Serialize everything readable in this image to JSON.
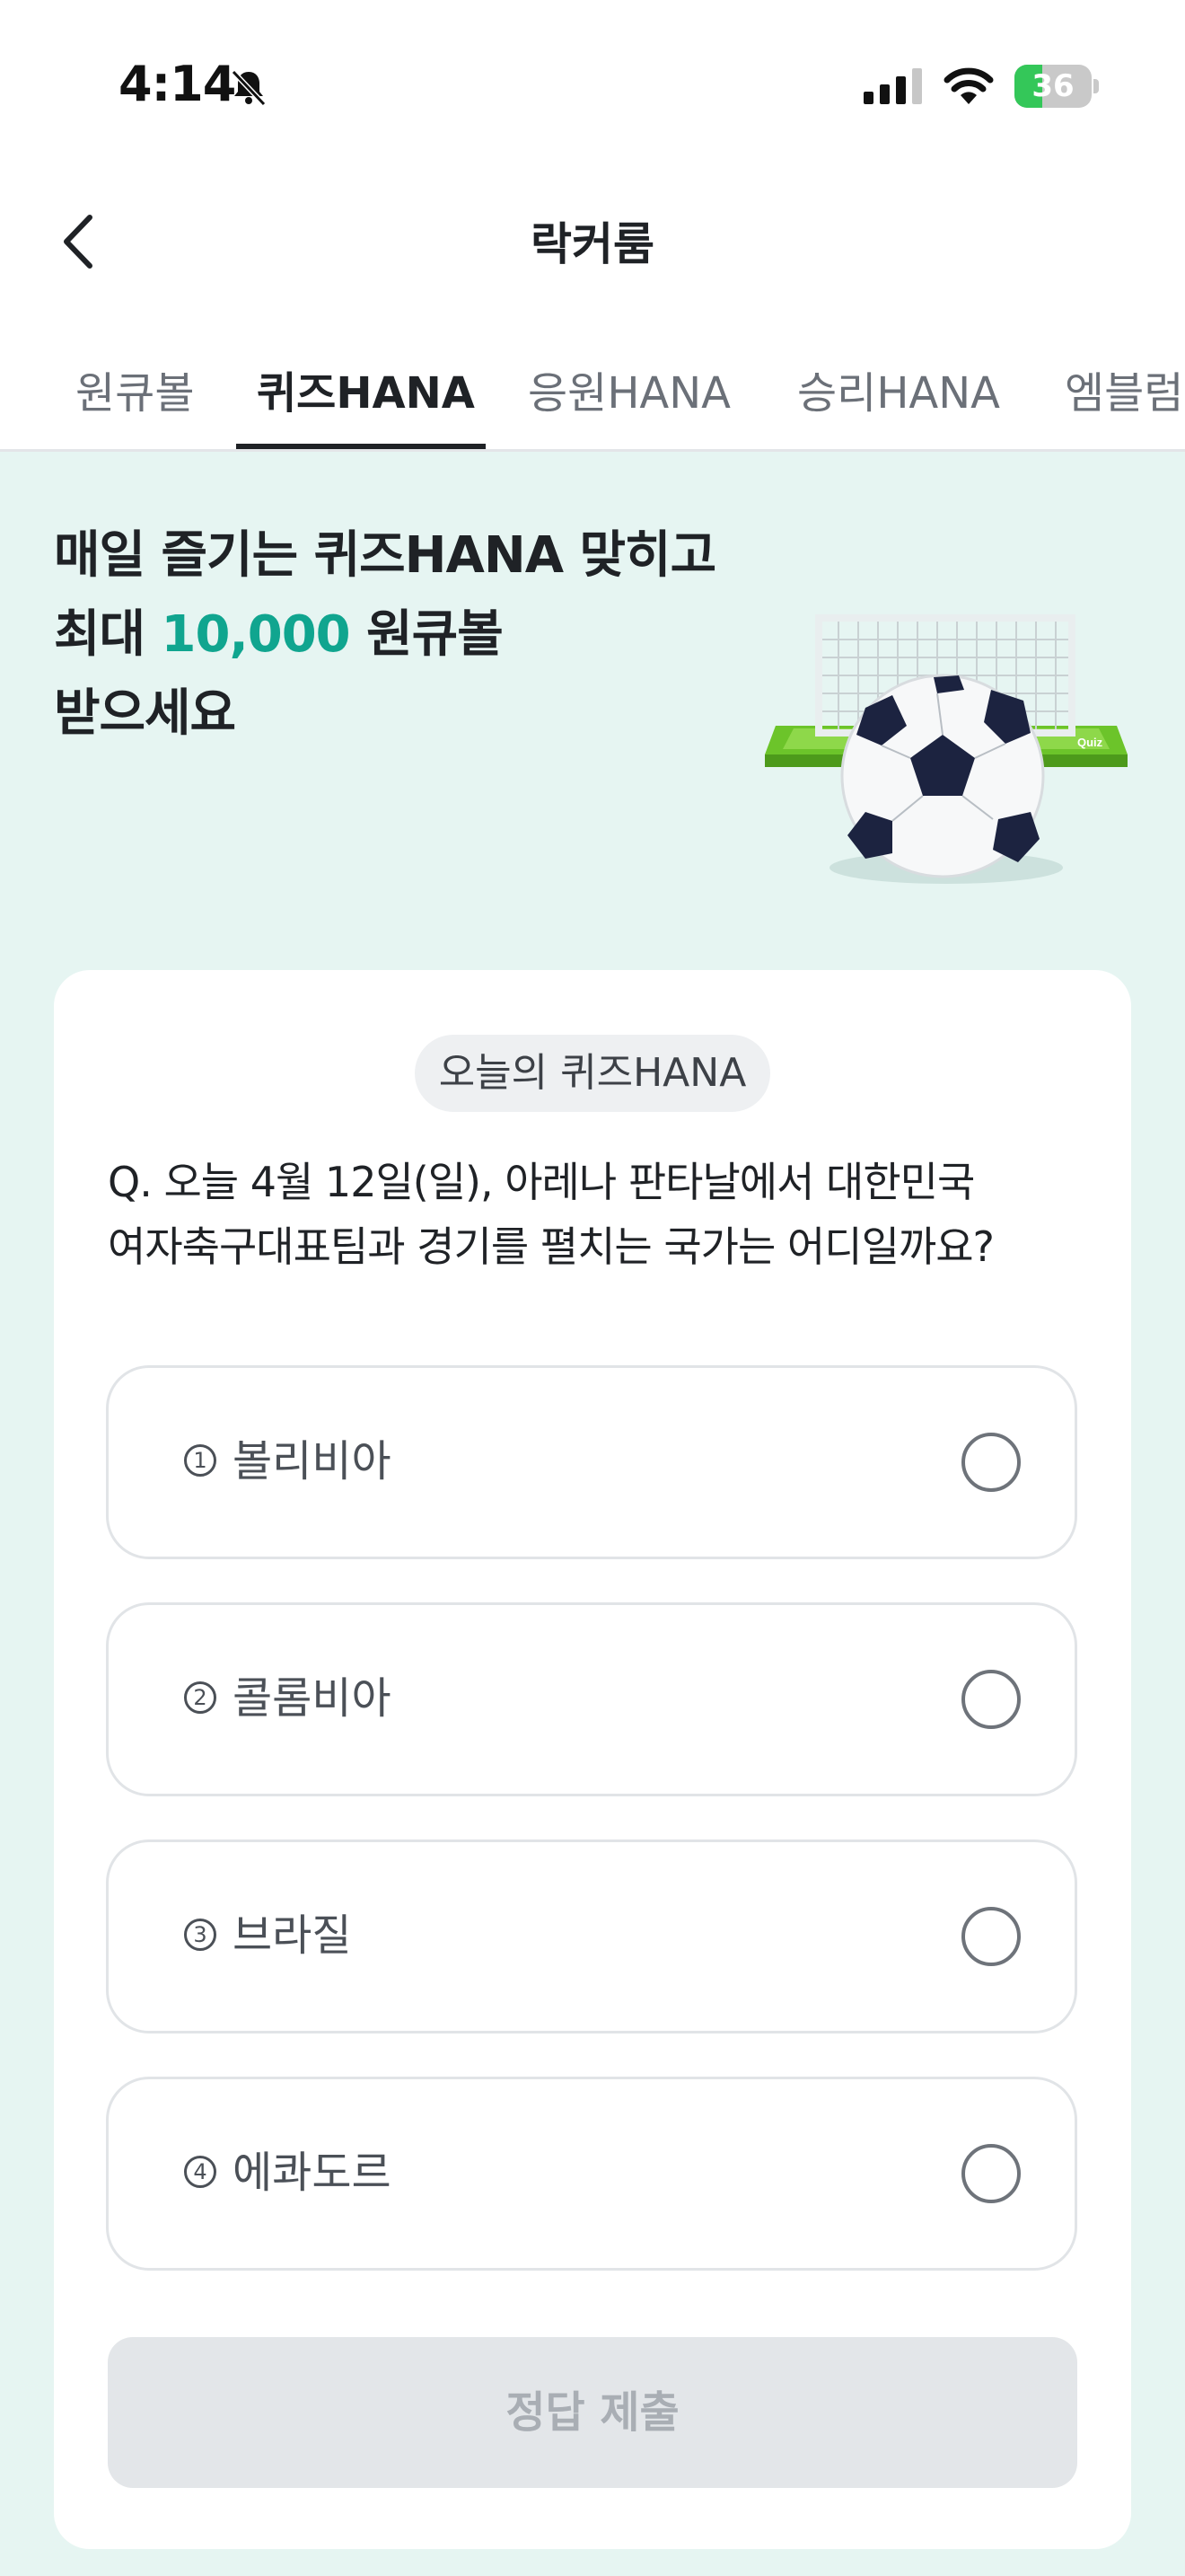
{
  "status_bar": {
    "time": "4:14",
    "battery_level": "36",
    "battery_fill": 0.36,
    "battery_color": "#34c759"
  },
  "nav": {
    "title": "락커룸",
    "back_icon": "chevron-left-icon"
  },
  "tabs": [
    {
      "label": "원큐볼",
      "active": false
    },
    {
      "label": "퀴즈HANA",
      "active": true
    },
    {
      "label": "응원HANA",
      "active": false
    },
    {
      "label": "승리HANA",
      "active": false
    },
    {
      "label": "엠블럼",
      "active": false
    }
  ],
  "banner": {
    "line1": "매일 즐기는 퀴즈HANA 맞히고",
    "line2_prefix": "최대 ",
    "line2_highlight": "10,000",
    "line2_suffix": " 원큐볼",
    "line3": "받으세요",
    "highlight_color": "#10a58f",
    "illustration_label": "Quiz"
  },
  "quiz": {
    "badge": "오늘의 퀴즈HANA",
    "question_line1": "Q. 오늘 4월 12일(일), 아레나 판타날에서 대한민국",
    "question_line2": "여자축구대표팀과 경기를 펼치는 국가는 어디일까요?",
    "options": [
      {
        "number": "1",
        "label": "볼리비아"
      },
      {
        "number": "2",
        "label": "콜롬비아"
      },
      {
        "number": "3",
        "label": "브라질"
      },
      {
        "number": "4",
        "label": "에콰도르"
      }
    ],
    "submit_label": "정답 제출"
  },
  "colors": {
    "background": "#e6f5f2",
    "accent": "#10a58f",
    "goal_green": "#6cc42a"
  }
}
